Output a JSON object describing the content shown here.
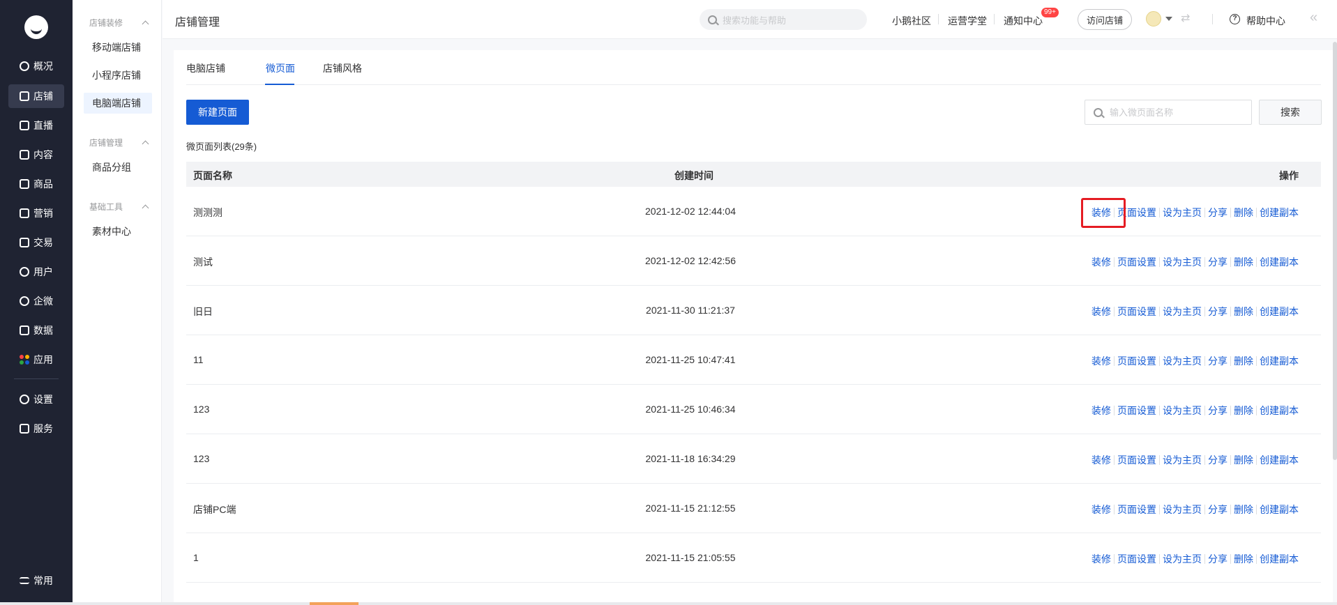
{
  "nav": {
    "items": [
      {
        "label": "概况",
        "icon": "overview-icon"
      },
      {
        "label": "店铺",
        "icon": "store-icon"
      },
      {
        "label": "直播",
        "icon": "live-icon"
      },
      {
        "label": "内容",
        "icon": "content-icon"
      },
      {
        "label": "商品",
        "icon": "goods-icon"
      },
      {
        "label": "营销",
        "icon": "marketing-icon"
      },
      {
        "label": "交易",
        "icon": "trade-icon"
      },
      {
        "label": "用户",
        "icon": "user-icon"
      },
      {
        "label": "企微",
        "icon": "wecom-icon"
      },
      {
        "label": "数据",
        "icon": "data-icon"
      },
      {
        "label": "应用",
        "icon": "apps-icon"
      },
      {
        "label": "设置",
        "icon": "settings-icon"
      },
      {
        "label": "服务",
        "icon": "service-icon"
      }
    ],
    "bottom_label": "常用"
  },
  "subnav": {
    "group1": "店铺装修",
    "group1_items": [
      "移动端店铺",
      "小程序店铺",
      "电脑端店铺"
    ],
    "group2": "店铺管理",
    "group2_items": [
      "商品分组"
    ],
    "group3": "基础工具",
    "group3_items": [
      "素材中心"
    ]
  },
  "header": {
    "title": "店铺管理",
    "search_placeholder": "搜索功能与帮助",
    "links": [
      "小鹅社区",
      "运营学堂",
      "通知中心"
    ],
    "badge": "99+",
    "visit_store": "访问店铺",
    "help": "帮助中心"
  },
  "tabs": [
    "电脑店铺",
    "微页面",
    "店铺风格"
  ],
  "toolbar": {
    "new_page": "新建页面",
    "search_placeholder": "输入微页面名称",
    "search_button": "搜索"
  },
  "list_count": "微页面列表(29条)",
  "table": {
    "headers": [
      "页面名称",
      "创建时间",
      "操作"
    ],
    "actions": [
      "装修",
      "页面设置",
      "设为主页",
      "分享",
      "删除",
      "创建副本"
    ],
    "rows": [
      {
        "name": "测测测",
        "time": "2021-12-02 12:44:04"
      },
      {
        "name": "测试",
        "time": "2021-12-02 12:42:56"
      },
      {
        "name": "旧日",
        "time": "2021-11-30 11:21:37"
      },
      {
        "name": "11",
        "time": "2021-11-25 10:47:41"
      },
      {
        "name": "123",
        "time": "2021-11-25 10:46:34"
      },
      {
        "name": "123",
        "time": "2021-11-18 16:34:29"
      },
      {
        "name": "店铺PC端",
        "time": "2021-11-15 21:12:55"
      },
      {
        "name": "1",
        "time": "2021-11-15 21:05:55"
      }
    ]
  },
  "colors": {
    "accent": "#155bd4",
    "nav_bg": "#1f2332",
    "highlight": "#e51c23"
  }
}
